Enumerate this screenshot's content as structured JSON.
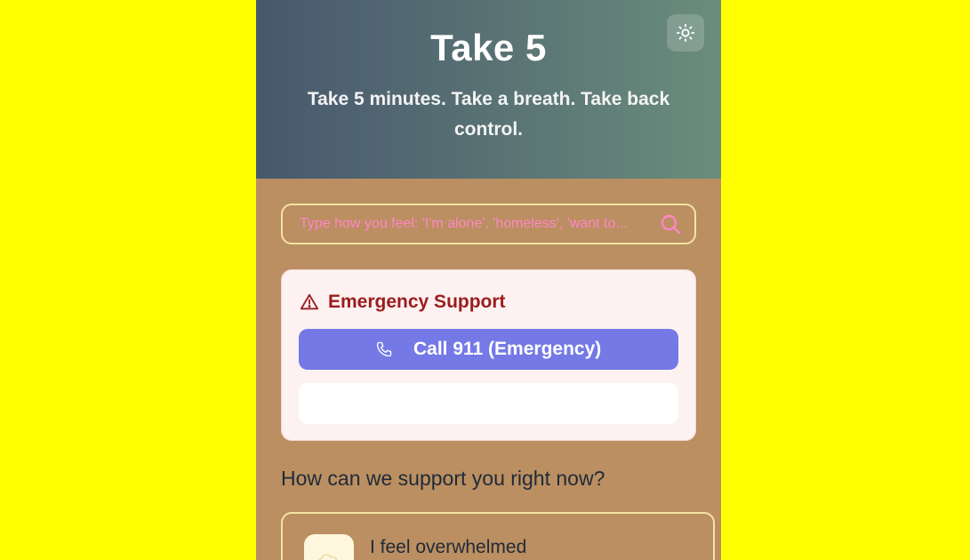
{
  "header": {
    "title": "Take 5",
    "subtitle": "Take 5 minutes. Take a breath. Take back control."
  },
  "search": {
    "placeholder": "Type how you feel: 'I'm alone', 'homeless', 'want to..."
  },
  "emergency": {
    "heading": "Emergency Support",
    "call_label": "Call 911 (Emergency)",
    "secondary_label": ""
  },
  "support": {
    "title": "How can we support you right now?",
    "options": [
      {
        "label": "I feel overwhelmed",
        "icon": "cloud-icon"
      }
    ]
  },
  "colors": {
    "page_bg": "#ffff00",
    "app_bg": "#bb8f61",
    "accent": "#7479e6",
    "danger": "#9b1c1c",
    "search_text": "#ff86c8"
  }
}
